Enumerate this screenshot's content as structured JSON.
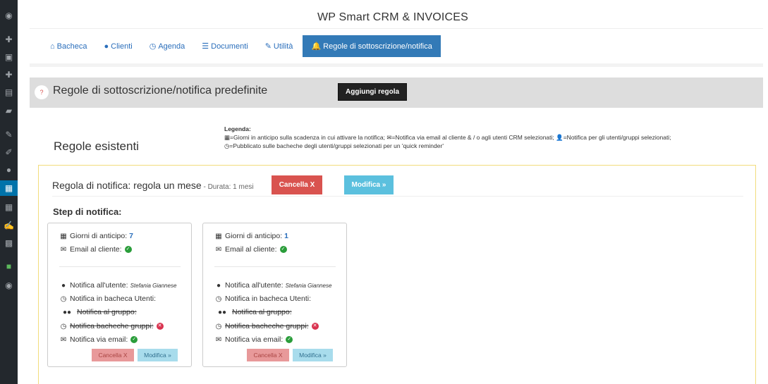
{
  "app_title": "WP Smart CRM & INVOICES",
  "nav": [
    {
      "icon": "home-icon",
      "glyph": "⌂",
      "label": "Bacheca"
    },
    {
      "icon": "user-icon",
      "glyph": "●",
      "label": "Clienti"
    },
    {
      "icon": "clock-icon",
      "glyph": "◷",
      "label": "Agenda"
    },
    {
      "icon": "list-icon",
      "glyph": "☰",
      "label": "Documenti"
    },
    {
      "icon": "wrench-icon",
      "glyph": "✎",
      "label": "Utilità"
    },
    {
      "icon": "bell-icon",
      "glyph": "🔔",
      "label": "Regole di sottoscrizione/notifica"
    }
  ],
  "rulebar": {
    "help": "?",
    "heading": "Regole di sottoscrizione/notifica predefinite",
    "add_button": "Aggiungi regola"
  },
  "existing_title": "Regole esistenti",
  "legend": {
    "title": "Legenda:",
    "line1": "▦=Giorni in anticipo sulla scadenza in cui attivare la notifica; ✉=Notifica via email al cliente & / o agli utenti CRM selezionati; 👤=Notifica per gli utenti/gruppi selezionati;",
    "line2": "◷=Pubblicato sulle bacheche degli utenti/gruppi selezionati per un 'quick reminder'"
  },
  "rule": {
    "title": "Regola di notifica: regola un mese",
    "duration": " - Durata: 1 mesi",
    "cancel_label": "Cancella X",
    "edit_label": "Modifica »",
    "steps_title": "Step di notifica:"
  },
  "steps": [
    {
      "days_label": "Giorni di anticipo:",
      "days": "7",
      "email_client": "Email al cliente:",
      "notify_user": "Notifica all'utente:",
      "user_name": "Stefania Giannese",
      "board_users": "Notifica in bacheca Utenti:",
      "notify_group": "Notifica al gruppo:",
      "board_groups": "Notifica bacheche gruppi:",
      "notify_email": "Notifica via email:",
      "cancel": "Cancella X",
      "edit": "Modifica »"
    },
    {
      "days_label": "Giorni di anticipo:",
      "days": "1",
      "email_client": "Email al cliente:",
      "notify_user": "Notifica all'utente:",
      "user_name": "Stefania Giannese",
      "board_users": "Notifica in bacheca Utenti:",
      "notify_group": "Notifica al gruppo:",
      "board_groups": "Notifica bacheche gruppi:",
      "notify_email": "Notifica via email:",
      "cancel": "Cancella X",
      "edit": "Modifica »"
    }
  ],
  "sidebar_icons": [
    "dashboard-icon",
    "pin-icon",
    "media-icon",
    "pin-icon",
    "pages-icon",
    "comments-icon",
    "appearance-icon",
    "plugins-icon",
    "users-icon",
    "crm-icon",
    "crm-icon",
    "tools-icon",
    "settings-icon",
    "plugin-icon",
    "collapse-icon"
  ]
}
